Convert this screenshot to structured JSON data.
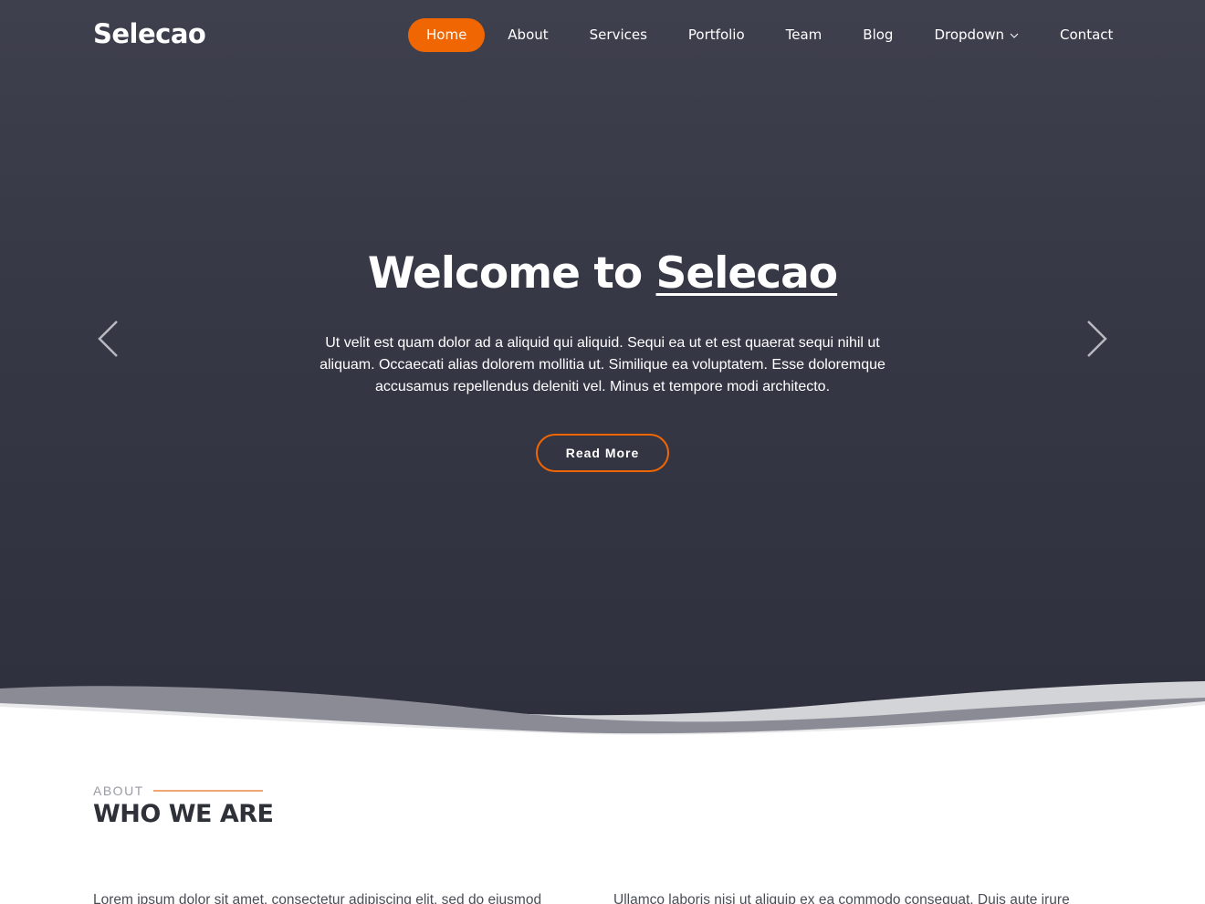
{
  "header": {
    "logo": "Selecao",
    "nav": [
      {
        "label": "Home",
        "active": true
      },
      {
        "label": "About"
      },
      {
        "label": "Services"
      },
      {
        "label": "Portfolio"
      },
      {
        "label": "Team"
      },
      {
        "label": "Blog"
      },
      {
        "label": "Dropdown",
        "has_dropdown": true
      },
      {
        "label": "Contact"
      }
    ]
  },
  "hero": {
    "title_prefix": "Welcome to ",
    "title_brand": "Selecao",
    "text": "Ut velit est quam dolor ad a aliquid qui aliquid. Sequi ea ut et est quaerat sequi nihil ut aliquam. Occaecati alias dolorem mollitia ut. Similique ea voluptatem. Esse doloremque accusamus repellendus deleniti vel. Minus et tempore modi architecto.",
    "button_label": "Read More",
    "prev_icon": "chevron-left-icon",
    "next_icon": "chevron-right-icon"
  },
  "about": {
    "label": "ABOUT",
    "title": "WHO WE ARE",
    "col_left": "Lorem ipsum dolor sit amet, consectetur adipiscing elit, sed do eiusmod",
    "col_right": "Ullamco laboris nisi ut aliquip ex ea commodo consequat. Duis aute irure"
  },
  "colors": {
    "accent": "#ef6603",
    "hero_bg": "#363846",
    "heading": "#2f3138"
  }
}
